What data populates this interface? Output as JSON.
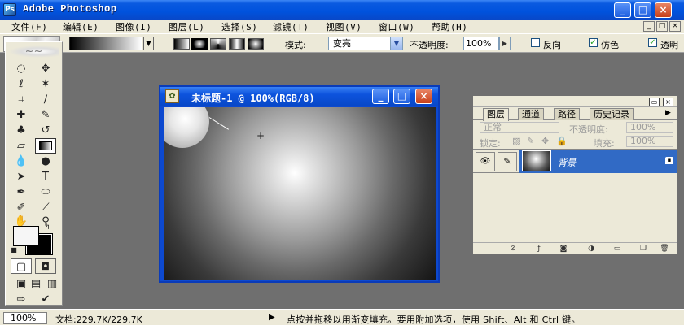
{
  "app": {
    "title": "Adobe Photoshop"
  },
  "menu": {
    "items": [
      {
        "label": "文件(F)"
      },
      {
        "label": "编辑(E)"
      },
      {
        "label": "图像(I)"
      },
      {
        "label": "图层(L)"
      },
      {
        "label": "选择(S)"
      },
      {
        "label": "滤镜(T)"
      },
      {
        "label": "视图(V)"
      },
      {
        "label": "窗口(W)"
      },
      {
        "label": "帮助(H)"
      }
    ]
  },
  "options": {
    "mode_label": "模式:",
    "mode_value": "变亮",
    "opacity_label": "不透明度:",
    "opacity_value": "100%",
    "reverse_label": "反向",
    "reverse_checked": false,
    "dither_label": "仿色",
    "dither_checked": true,
    "transparency_label": "透明",
    "transparency_checked": true
  },
  "document": {
    "title": "未标题-1 @ 100%(RGB/8)"
  },
  "layers_panel": {
    "tabs": [
      {
        "label": "图层"
      },
      {
        "label": "通道"
      },
      {
        "label": "路径"
      },
      {
        "label": "历史记录"
      }
    ],
    "blend_mode": "正常",
    "opacity_label": "不透明度:",
    "opacity_value": "100%",
    "lock_label": "锁定:",
    "fill_label": "填充:",
    "fill_value": "100%",
    "layer_name": "背景"
  },
  "status": {
    "zoom": "100%",
    "doc_info": "文档:229.7K/229.7K",
    "hint": "点按并拖移以用渐变填充。要用附加选项，使用 Shift、Alt 和 Ctrl 键。"
  },
  "colors": {
    "title_bar": "#0052dd",
    "chrome": "#ece9d8",
    "workspace": "#6f6f6f",
    "layer_selected": "#316ac5",
    "foreground": "#f6f6f6",
    "background": "#000000"
  }
}
